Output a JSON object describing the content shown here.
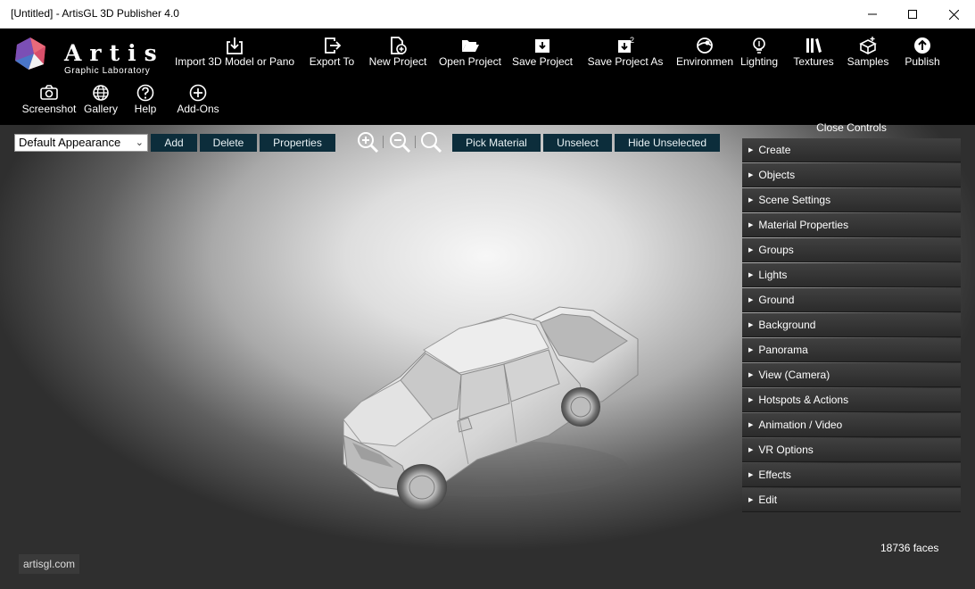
{
  "window": {
    "title": "[Untitled] - ArtisGL 3D Publisher 4.0"
  },
  "logo": {
    "name": "Artis",
    "subtitle": "Graphic Laboratory"
  },
  "toolbar": {
    "row1": [
      {
        "label": "Import 3D Model or Pano",
        "icon": "import-icon"
      },
      {
        "label": "Export To",
        "icon": "export-icon"
      },
      {
        "label": "New Project",
        "icon": "new-project-icon"
      },
      {
        "label": "Open Project",
        "icon": "folder-open-icon"
      },
      {
        "label": "Save Project",
        "icon": "save-icon"
      },
      {
        "label": "Save Project As",
        "icon": "save-as-icon"
      },
      {
        "label": "Environmen",
        "icon": "environment-icon"
      },
      {
        "label": "Lighting",
        "icon": "lightbulb-icon"
      },
      {
        "label": "Textures",
        "icon": "textures-icon"
      },
      {
        "label": "Samples",
        "icon": "samples-icon"
      },
      {
        "label": "Publish",
        "icon": "publish-globe-icon"
      }
    ],
    "row2": [
      {
        "label": "Screenshot",
        "icon": "camera-icon"
      },
      {
        "label": "Gallery",
        "icon": "globe-icon"
      },
      {
        "label": "Help",
        "icon": "help-icon"
      },
      {
        "label": "Add-Ons",
        "icon": "plus-circle-icon"
      }
    ]
  },
  "appearance": {
    "selected": "Default Appearance",
    "buttons": {
      "add": "Add",
      "delete": "Delete",
      "properties": "Properties"
    }
  },
  "material_buttons": {
    "pick": "Pick Material",
    "unselect": "Unselect",
    "hide": "Hide Unselected"
  },
  "controls": {
    "close_label": "Close Controls",
    "items": [
      "Create",
      "Objects",
      "Scene Settings",
      "Material Properties",
      "Groups",
      "Lights",
      "Ground",
      "Background",
      "Panorama",
      "View (Camera)",
      "Hotspots & Actions",
      "Animation / Video",
      "VR Options",
      "Effects",
      "Edit"
    ]
  },
  "status": {
    "faces": "18736 faces",
    "site": "artisgl.com"
  },
  "colors": {
    "accent_button": "#0c2d3b",
    "panel_item": "#353535",
    "toolbar_bg": "#000000"
  }
}
